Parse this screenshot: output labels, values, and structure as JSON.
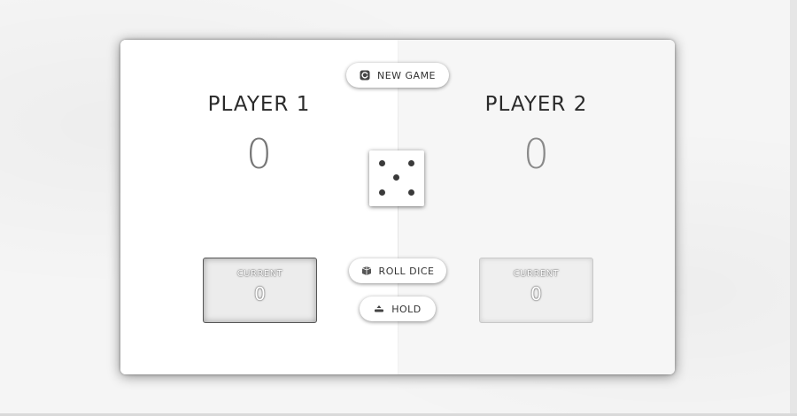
{
  "game": {
    "new_game_label": "NEW GAME",
    "roll_dice_label": "ROLL DICE",
    "hold_label": "HOLD",
    "dice_value": 5
  },
  "players": [
    {
      "name": "PLAYER 1",
      "score": "0",
      "current_label": "CURRENT",
      "current_score": "0",
      "active": true
    },
    {
      "name": "PLAYER 2",
      "score": "0",
      "current_label": "CURRENT",
      "current_score": "0",
      "active": false
    }
  ],
  "icons": {
    "new_game": "refresh-icon",
    "roll_dice": "dice-icon",
    "hold": "hold-icon"
  }
}
